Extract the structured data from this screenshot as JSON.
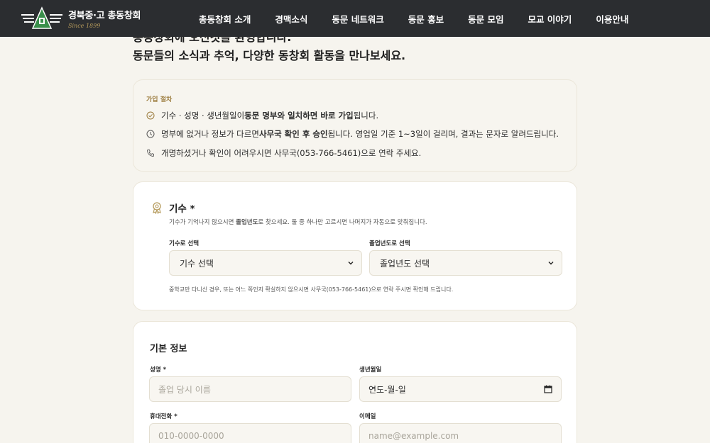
{
  "header": {
    "logo_title": "경북중·고 총동창회",
    "logo_since": "Since 1899",
    "nav": [
      "총동창회 소개",
      "경맥소식",
      "동문 네트워크",
      "동문 홍보",
      "동문 모임",
      "모교 이야기",
      "이용안내"
    ]
  },
  "intro": {
    "line1": "총동창회에 오신것을 환영합니다.",
    "line2": "동문들의 소식과 추억, 다양한 동창회 활동을 만나보세요."
  },
  "procedure": {
    "label": "가입 절차",
    "row1_pre": "기수 · 성명 · 생년월일이 ",
    "row1_bold": "동문 명부와 일치하면 바로 가입",
    "row1_post": "됩니다.",
    "row2_pre": "명부에 없거나 정보가 다르면 ",
    "row2_bold": "사무국 확인 후 승인",
    "row2_post": "됩니다. 영업일 기준 1~3일이 걸리며, 결과는 문자로 알려드립니다.",
    "row3": "개명하셨거나 확인이 어려우시면 사무국(053-766-5461)으로 연락 주세요."
  },
  "generation": {
    "title": "기수 *",
    "desc_pre": "기수가 기억나지 않으시면 ",
    "desc_bold": "졸업년도",
    "desc_post": "로 찾으세요. 둘 중 하나만 고르시면 나머지가 자동으로 맞춰집니다.",
    "by_gen_label": "기수로 선택",
    "by_gen_value": "기수 선택",
    "by_year_label": "졸업년도로 선택",
    "by_year_value": "졸업년도 선택",
    "note": "중학교만 다니신 경우, 또는 어느 쪽인지 확실하지 않으시면 사무국(053-766-5461)으로 연락 주시면 확인해 드립니다."
  },
  "basic": {
    "title": "기본 정보",
    "name_label": "성명 *",
    "name_placeholder": "졸업 당시 이름",
    "birth_label": "생년월일",
    "birth_value": "연도-월-일",
    "phone_label": "휴대전화 *",
    "phone_placeholder": "010-0000-0000",
    "email_label": "이메일",
    "email_placeholder": "name@example.com"
  },
  "colors": {
    "header_bg": "#2b2d30",
    "accent_gold": "#b59a5b",
    "logo_green": "#3a8f4b",
    "page_bg": "#f6f4ee"
  }
}
